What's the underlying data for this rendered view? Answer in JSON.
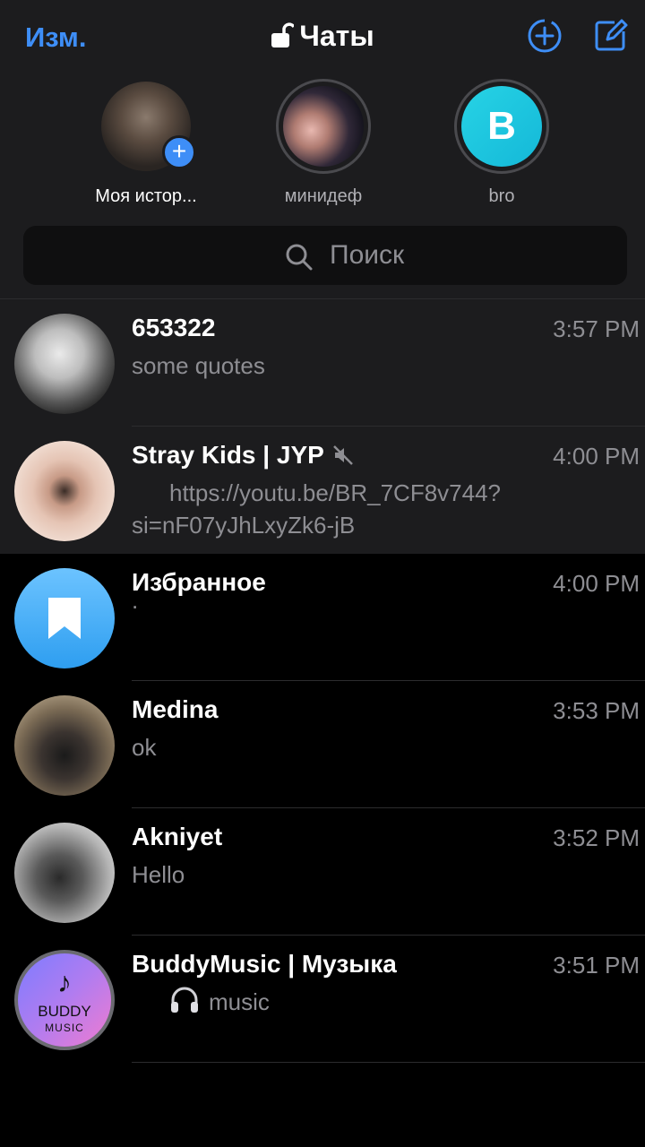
{
  "header": {
    "edit_label": "Изм.",
    "title": "Чаты",
    "new_story_icon": "add-story-icon",
    "compose_icon": "compose-icon",
    "accent": "#3e8ef7"
  },
  "stories": [
    {
      "name": "Моя истор..."
    },
    {
      "name": "минидеф"
    },
    {
      "name": "bro",
      "initial": "B"
    }
  ],
  "search": {
    "placeholder": "Поиск"
  },
  "chats": [
    {
      "name": "653322",
      "time": "3:57 PM",
      "message": "some quotes"
    },
    {
      "name": "Stray Kids | JYP",
      "time": "4:00 PM",
      "message_line1": "https://youtu.be/BR_7CF8v744?",
      "message_line2": "si=nF07yJhLxyZk6-jB"
    },
    {
      "name": "Избранное",
      "time": "4:00 PM",
      "message": "."
    },
    {
      "name": "Medina",
      "time": "3:53 PM",
      "message": "ok"
    },
    {
      "name": "Akniyet",
      "time": "3:52 PM",
      "message": "Hello"
    },
    {
      "name": "BuddyMusic | Музыка",
      "time": "3:51 PM",
      "message": "music",
      "logo_line1": "BUDDY",
      "logo_line2": "MUSIC"
    }
  ]
}
